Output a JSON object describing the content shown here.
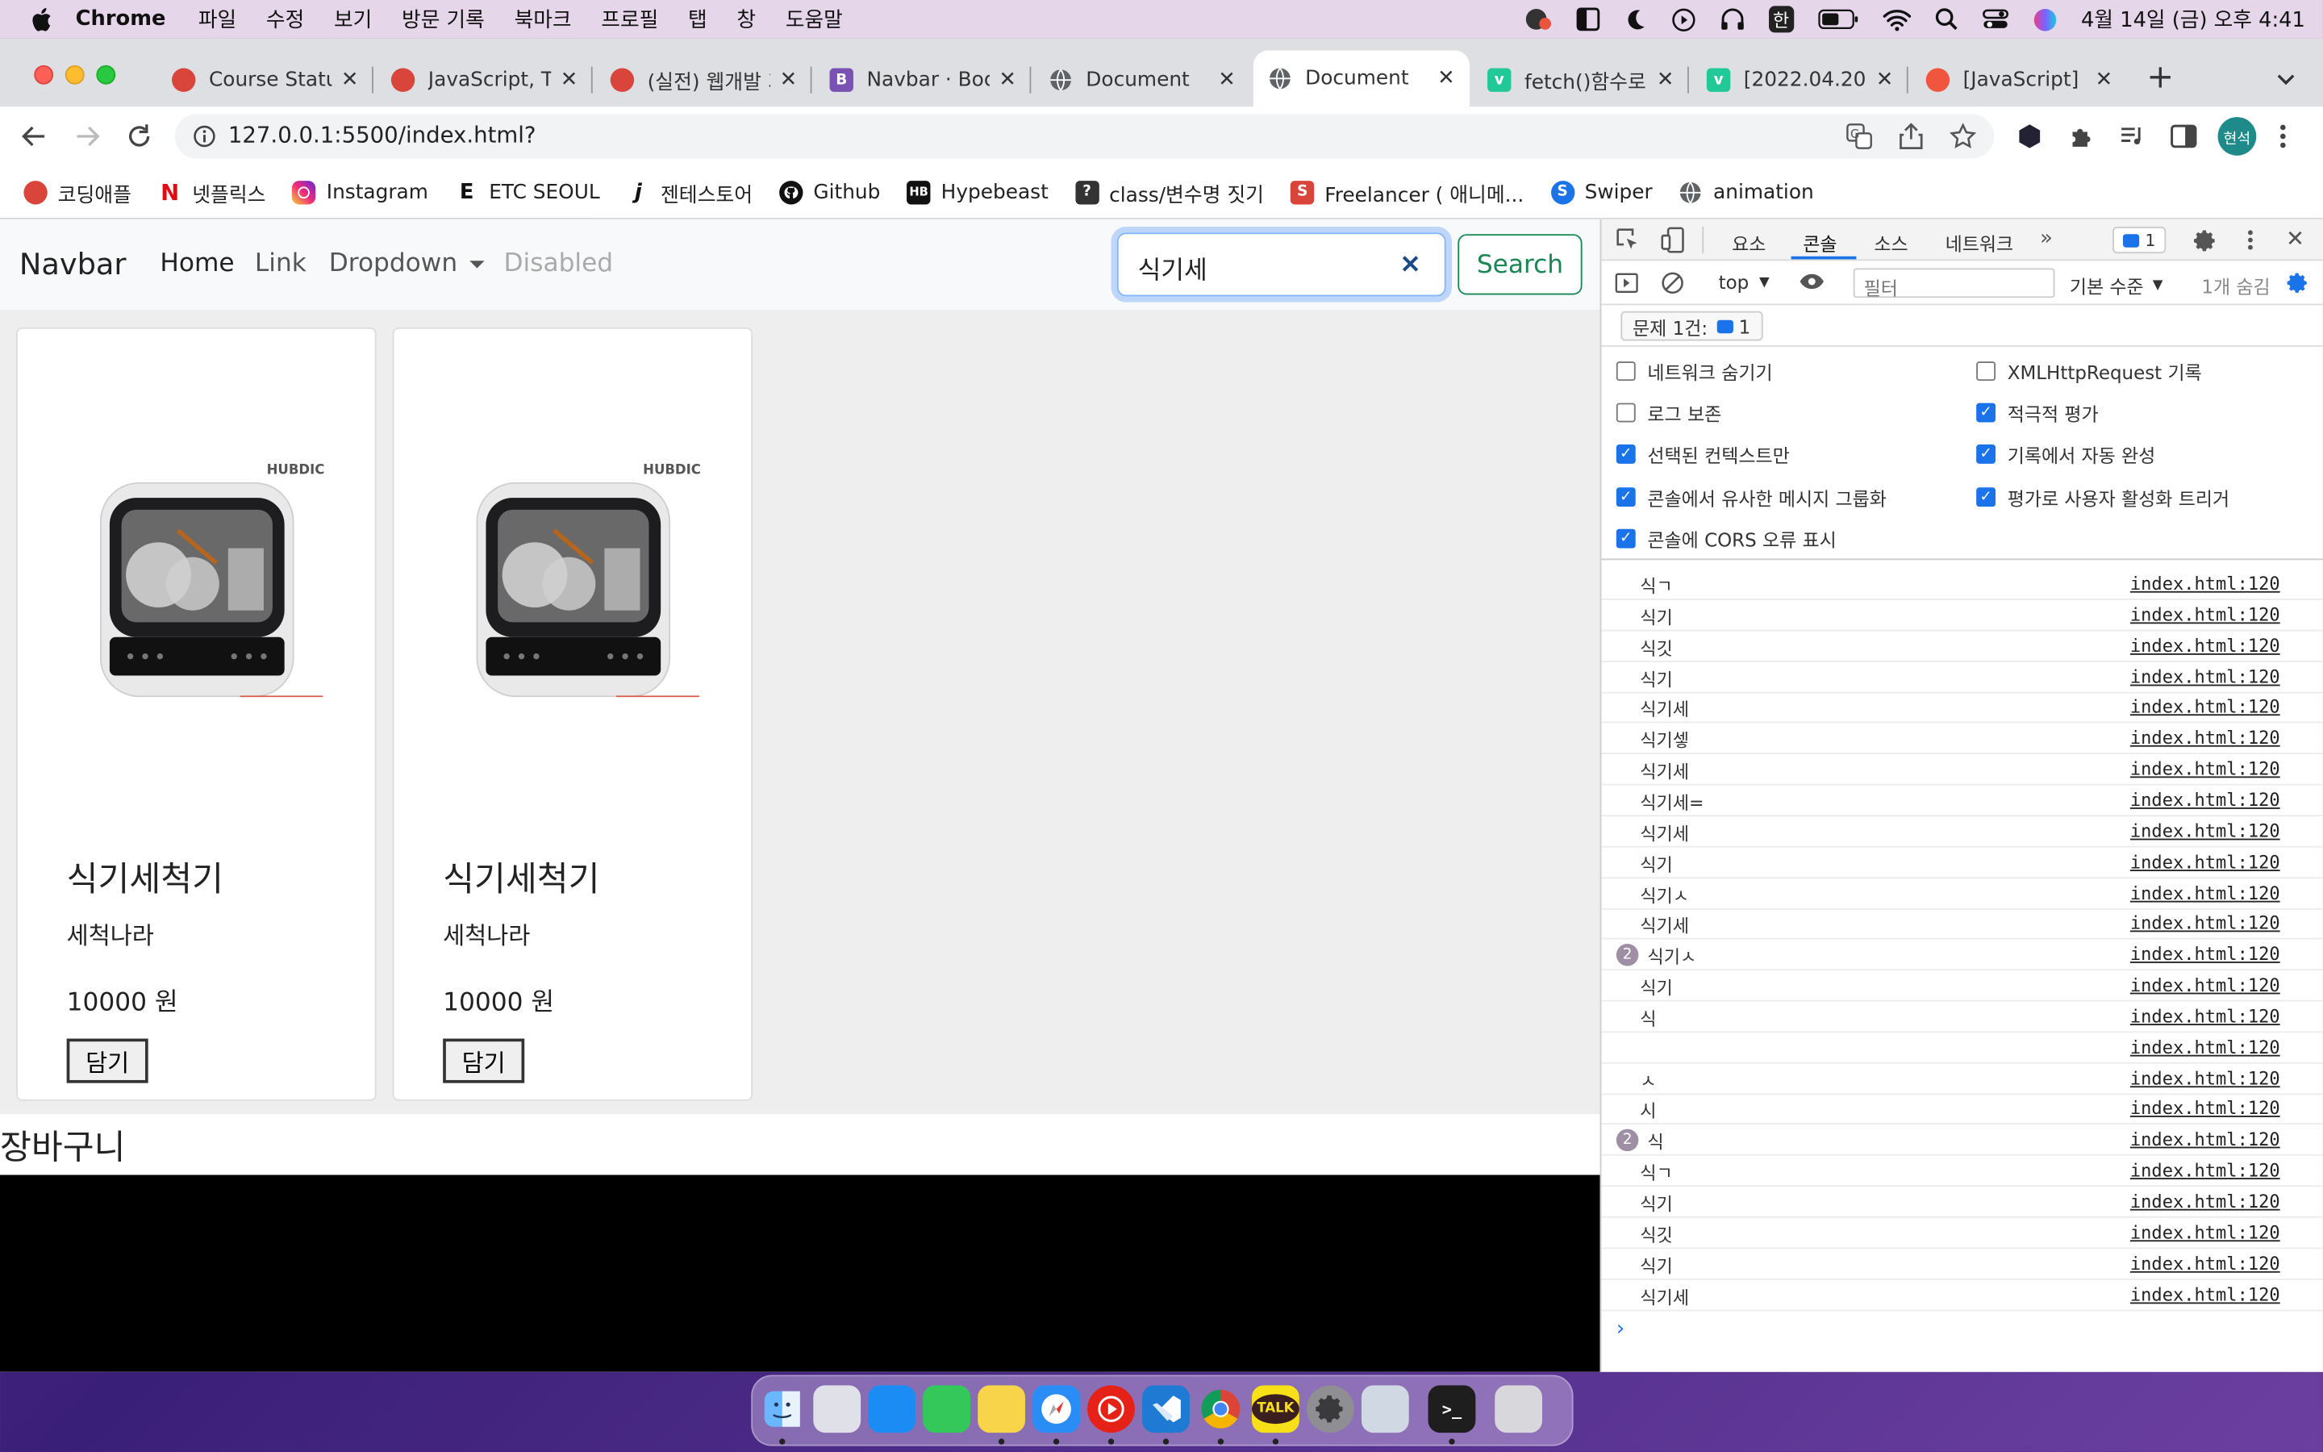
{
  "menubar": {
    "app": "Chrome",
    "items": [
      "파일",
      "수정",
      "보기",
      "방문 기록",
      "북마크",
      "프로필",
      "탭",
      "창",
      "도움말"
    ],
    "ime": "한",
    "clock": "4월 14일 (금) 오후 4:41"
  },
  "tabs": [
    {
      "title": "Course Status",
      "icon": "apple-icon",
      "color": "#d9453b"
    },
    {
      "title": "JavaScript, T",
      "icon": "apple-icon",
      "color": "#d9453b"
    },
    {
      "title": "(실전) 웹개발 기",
      "icon": "apple-icon",
      "color": "#d9453b"
    },
    {
      "title": "Navbar · Boot",
      "icon": "bootstrap-icon",
      "color": "#7952b3"
    },
    {
      "title": "Document",
      "icon": "globe-icon",
      "color": "#5f6368"
    },
    {
      "title": "Document",
      "icon": "globe-icon",
      "color": "#5f6368",
      "active": true
    },
    {
      "title": "fetch()함수로",
      "icon": "velog-icon",
      "color": "#20c997"
    },
    {
      "title": "[2022.04.20]",
      "icon": "velog-icon",
      "color": "#20c997"
    },
    {
      "title": "[JavaScript]",
      "icon": "tistory-icon",
      "color": "#f0553d"
    }
  ],
  "address": {
    "url": "127.0.0.1:5500/index.html?"
  },
  "profile": {
    "label": "현석"
  },
  "bookmarks": [
    {
      "label": "코딩애플",
      "icon": "apple-icon",
      "color": "#d9453b"
    },
    {
      "label": "넷플릭스",
      "icon": "netflix-icon",
      "color": "#e50914"
    },
    {
      "label": "Instagram",
      "icon": "instagram-icon",
      "color": "#d6249f"
    },
    {
      "label": "ETC SEOUL",
      "icon": "etc-icon",
      "color": "#111111"
    },
    {
      "label": "젠테스토어",
      "icon": "j-icon",
      "color": "#111111"
    },
    {
      "label": "Github",
      "icon": "github-icon",
      "color": "#111111"
    },
    {
      "label": "Hypebeast",
      "icon": "hypebeast-icon",
      "color": "#111111"
    },
    {
      "label": "class/변수명 짓기",
      "icon": "question-icon",
      "color": "#333333"
    },
    {
      "label": "Freelancer ( 애니메...",
      "icon": "s-icon",
      "color": "#d9453b"
    },
    {
      "label": "Swiper",
      "icon": "swiper-icon",
      "color": "#1a73e8"
    },
    {
      "label": "animation",
      "icon": "globe-icon",
      "color": "#5f6368"
    }
  ],
  "navbar": {
    "brand": "Navbar",
    "links": [
      "Home",
      "Link",
      "Dropdown",
      "Disabled"
    ],
    "search_value": "식기세",
    "search_button": "Search"
  },
  "products": [
    {
      "name": "식기세척기",
      "brand": "세척나라",
      "price": "10000 원",
      "button": "담기",
      "logo": "HUBDIC"
    },
    {
      "name": "식기세척기",
      "brand": "세척나라",
      "price": "10000 원",
      "button": "담기",
      "logo": "HUBDIC"
    }
  ],
  "cart": {
    "title": "장바구니"
  },
  "devtools": {
    "tabs": [
      "요소",
      "콘솔",
      "소스",
      "네트워크"
    ],
    "issues_badge": "1",
    "context": "top",
    "filter_placeholder": "필터",
    "level": "기본 수준",
    "hidden": "1개 숨김",
    "issues_label": "문제 1건:",
    "issues_count": "1",
    "settings": [
      {
        "label": "네트워크 숨기기",
        "checked": false
      },
      {
        "label": "XMLHttpRequest 기록",
        "checked": false
      },
      {
        "label": "로그 보존",
        "checked": false
      },
      {
        "label": "적극적 평가",
        "checked": true
      },
      {
        "label": "선택된 컨텍스트만",
        "checked": true
      },
      {
        "label": "기록에서 자동 완성",
        "checked": true
      },
      {
        "label": "콘솔에서 유사한 메시지 그룹화",
        "checked": true
      },
      {
        "label": "평가로 사용자 활성화 트리거",
        "checked": true
      },
      {
        "label": "콘솔에 CORS 오류 표시",
        "checked": true
      }
    ],
    "log_source": "index.html:120",
    "log": [
      {
        "msg": "식ㄱ",
        "count": ""
      },
      {
        "msg": "식기",
        "count": ""
      },
      {
        "msg": "식깃",
        "count": ""
      },
      {
        "msg": "식기",
        "count": ""
      },
      {
        "msg": "식기세",
        "count": ""
      },
      {
        "msg": "식기셓",
        "count": ""
      },
      {
        "msg": "식기세",
        "count": ""
      },
      {
        "msg": "식기세=",
        "count": ""
      },
      {
        "msg": "식기세",
        "count": ""
      },
      {
        "msg": "식기",
        "count": ""
      },
      {
        "msg": "식기ㅅ",
        "count": ""
      },
      {
        "msg": "식기세",
        "count": ""
      },
      {
        "msg": "식기ㅅ",
        "count": "2"
      },
      {
        "msg": "식기",
        "count": ""
      },
      {
        "msg": "식",
        "count": ""
      },
      {
        "msg": "",
        "count": ""
      },
      {
        "msg": "ㅅ",
        "count": ""
      },
      {
        "msg": "시",
        "count": ""
      },
      {
        "msg": "식",
        "count": "2"
      },
      {
        "msg": "식ㄱ",
        "count": ""
      },
      {
        "msg": "식기",
        "count": ""
      },
      {
        "msg": "식깃",
        "count": ""
      },
      {
        "msg": "식기",
        "count": ""
      },
      {
        "msg": "식기세",
        "count": ""
      }
    ]
  },
  "dock": [
    {
      "name": "finder",
      "color": "#3a8df0"
    },
    {
      "name": "launchpad",
      "color": "#e0e0e8"
    },
    {
      "name": "app-store",
      "color": "#1c8cf5"
    },
    {
      "name": "facetime",
      "color": "#34c759"
    },
    {
      "name": "notes",
      "color": "#f7d44a"
    },
    {
      "name": "safari",
      "color": "#2a8df5"
    },
    {
      "name": "youtube-music",
      "color": "#e62117"
    },
    {
      "name": "vscode",
      "color": "#1f7ad3"
    },
    {
      "name": "chrome",
      "color": "#ffffff"
    },
    {
      "name": "kakaotalk",
      "color": "#f7e017",
      "label": "TALK"
    },
    {
      "name": "system-settings",
      "color": "#8e8e93"
    },
    {
      "name": "preview",
      "color": "#cfd8e3"
    },
    {
      "name": "terminal",
      "color": "#1e1e1e"
    },
    {
      "name": "trash",
      "color": "#d8d8dc"
    }
  ]
}
